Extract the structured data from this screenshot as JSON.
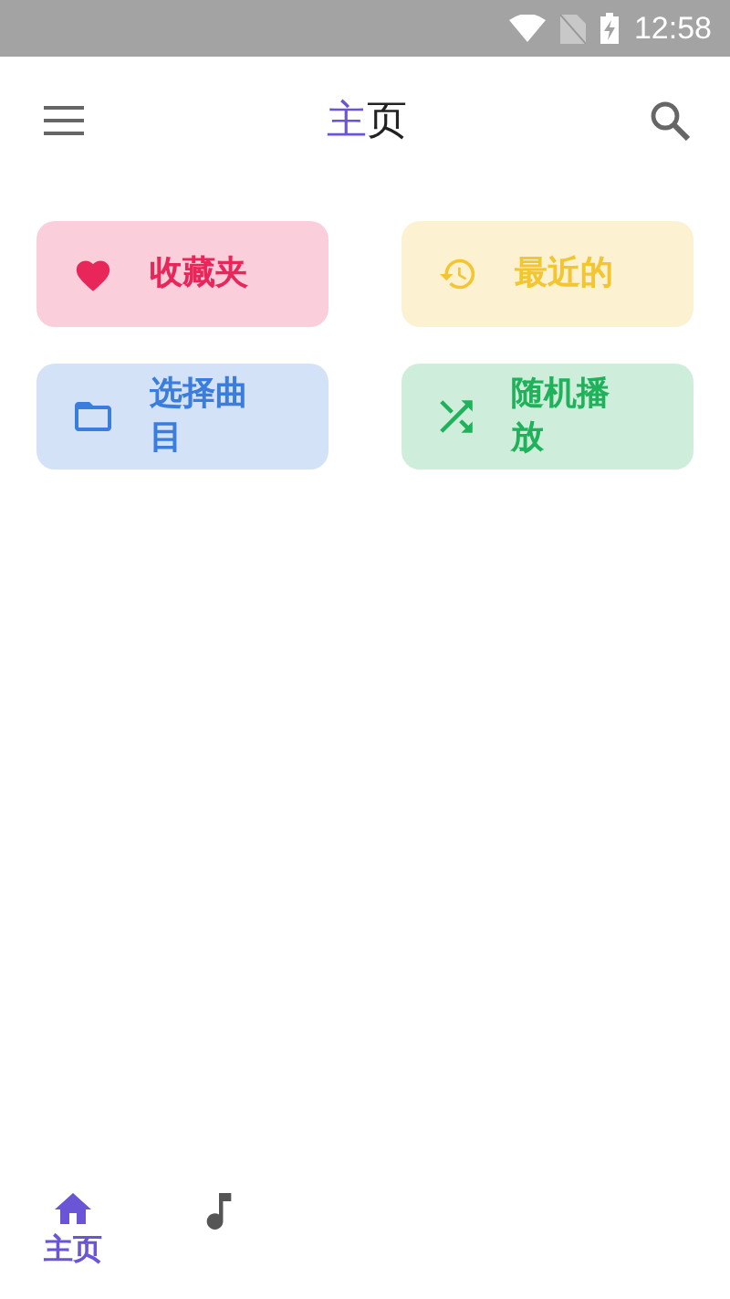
{
  "status_bar": {
    "time": "12:58"
  },
  "app_bar": {
    "title_accent": "主",
    "title_rest": "页"
  },
  "cards": [
    {
      "kind": "favorite",
      "label": "收藏夹",
      "color": "#e8265a"
    },
    {
      "kind": "recent",
      "label": "最近的",
      "color": "#f2c531"
    },
    {
      "kind": "folder",
      "label": "选择曲目",
      "color": "#3b7ddd"
    },
    {
      "kind": "shuffle",
      "label": "随机播放",
      "color": "#20b25b"
    }
  ],
  "bottom_nav": [
    {
      "kind": "home",
      "label": "主页",
      "selected": true
    },
    {
      "kind": "music",
      "selected": false
    }
  ]
}
